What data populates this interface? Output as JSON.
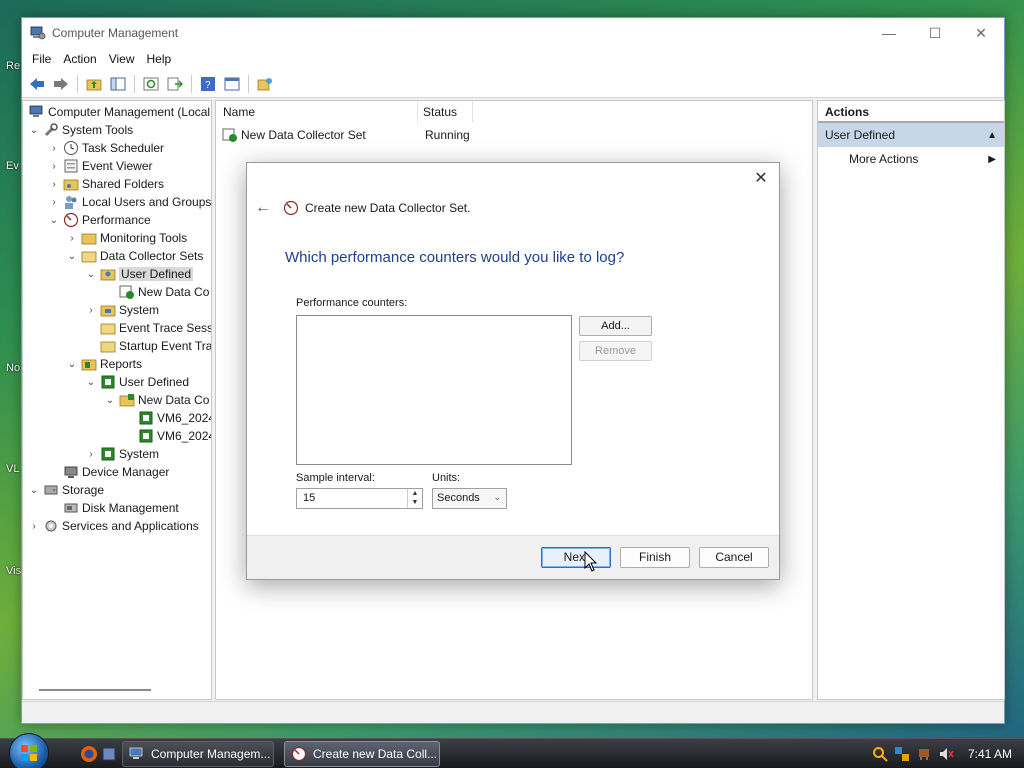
{
  "window": {
    "title": "Computer Management",
    "controls": [
      "—",
      "☐",
      "✕"
    ]
  },
  "menu": [
    "File",
    "Action",
    "View",
    "Help"
  ],
  "tree": {
    "items": [
      {
        "label": "Computer Management (Local",
        "arrow": ""
      },
      {
        "label": "System Tools",
        "arrow": "⌄"
      },
      {
        "label": "Task Scheduler",
        "arrow": "›"
      },
      {
        "label": "Event Viewer",
        "arrow": "›"
      },
      {
        "label": "Shared Folders",
        "arrow": "›"
      },
      {
        "label": "Local Users and Groups",
        "arrow": "›"
      },
      {
        "label": "Performance",
        "arrow": "⌄"
      },
      {
        "label": "Monitoring Tools",
        "arrow": "›"
      },
      {
        "label": "Data Collector Sets",
        "arrow": "⌄"
      },
      {
        "label": "User Defined",
        "arrow": "⌄",
        "selected": true
      },
      {
        "label": "New Data Co",
        "arrow": ""
      },
      {
        "label": "System",
        "arrow": "›"
      },
      {
        "label": "Event Trace Sess",
        "arrow": ""
      },
      {
        "label": "Startup Event Tra",
        "arrow": ""
      },
      {
        "label": "Reports",
        "arrow": "⌄"
      },
      {
        "label": "User Defined",
        "arrow": "⌄"
      },
      {
        "label": "New Data Co",
        "arrow": "⌄"
      },
      {
        "label": "VM6_2024",
        "arrow": ""
      },
      {
        "label": "VM6_2024",
        "arrow": ""
      },
      {
        "label": "System",
        "arrow": "›"
      },
      {
        "label": "Device Manager",
        "arrow": ""
      },
      {
        "label": "Storage",
        "arrow": "⌄"
      },
      {
        "label": "Disk Management",
        "arrow": ""
      },
      {
        "label": "Services and Applications",
        "arrow": "›"
      }
    ]
  },
  "list": {
    "columns": [
      "Name",
      "Status"
    ],
    "rows": [
      {
        "name": "New Data Collector Set",
        "status": "Running"
      }
    ]
  },
  "actions": {
    "title": "Actions",
    "section": "User Defined",
    "items": [
      "More Actions"
    ]
  },
  "dialog": {
    "title": "Create new Data Collector Set.",
    "question": "Which performance counters would you like to log?",
    "counters_label": "Performance counters:",
    "add_label": "Add...",
    "remove_label": "Remove",
    "sample_interval_label": "Sample interval:",
    "sample_interval_value": "15",
    "units_label": "Units:",
    "units_value": "Seconds",
    "next_label": "Next",
    "finish_label": "Finish",
    "cancel_label": "Cancel"
  },
  "desktop_labels": [
    "Re",
    "Ev",
    "No",
    "VL",
    "Vis"
  ],
  "taskbar": {
    "buttons": [
      "Computer Managem...",
      "Create new Data Coll..."
    ],
    "clock": "7:41 AM"
  },
  "colors": {
    "accent": "#2a6fd0",
    "question_text": "#1d3f8f",
    "actions_highlight": "#c7d7e8"
  }
}
